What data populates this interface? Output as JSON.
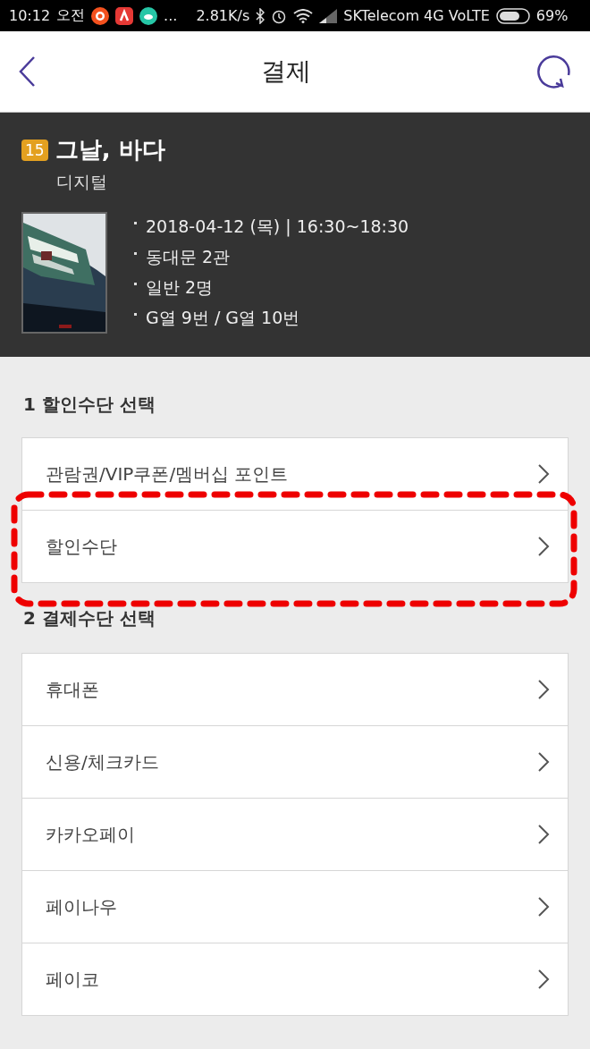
{
  "status_bar": {
    "time": "10:12",
    "ampm": "오전",
    "more": "...",
    "speed": "2.81K/s",
    "carrier": "SKTelecom 4G VoLTE",
    "battery": "69%"
  },
  "header": {
    "title": "결제"
  },
  "movie": {
    "rating": "15",
    "title": "그날, 바다",
    "format": "디지털",
    "poster": {
      "kind": "picture"
    },
    "details": [
      "2018-04-12 (목) | 16:30~18:30",
      "동대문 2관",
      "일반 2명",
      "G열 9번 / G열 10번"
    ]
  },
  "sections": [
    {
      "title": "1 할인수단 선택",
      "items": [
        {
          "label": "관람권/VIP쿠폰/멤버십 포인트",
          "highlighted": false
        },
        {
          "label": "할인수단",
          "highlighted": true
        }
      ]
    },
    {
      "title": "2 결제수단 선택",
      "items": [
        {
          "label": "휴대폰",
          "highlighted": false
        },
        {
          "label": "신용/체크카드",
          "highlighted": false
        },
        {
          "label": "카카오페이",
          "highlighted": false
        },
        {
          "label": "페이나우",
          "highlighted": false
        },
        {
          "label": "페이코",
          "highlighted": false
        }
      ]
    }
  ]
}
